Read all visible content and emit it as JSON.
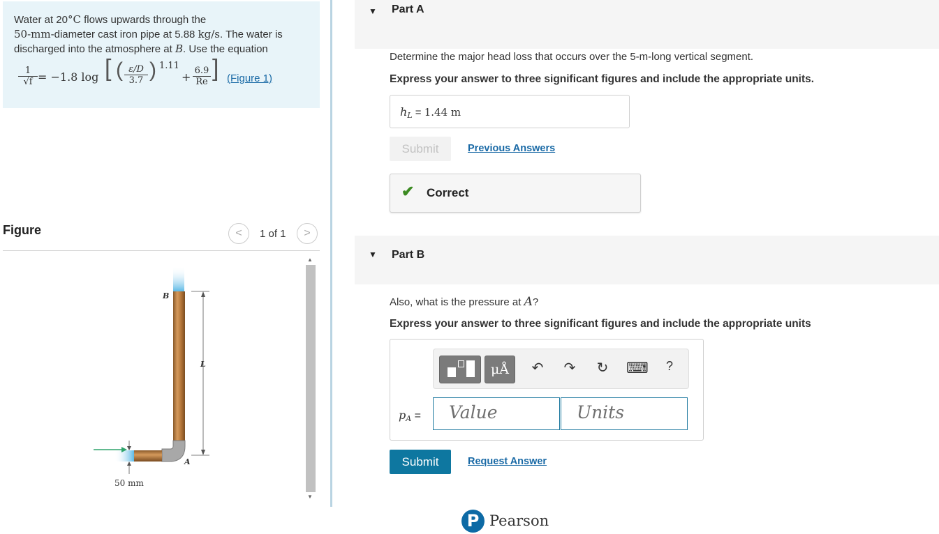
{
  "problem": {
    "line1_pre": "Water at 20",
    "line1_unit": "°C",
    "line1_post": " flows upwards through the",
    "line2_unit": "50-mm",
    "line2_mid": "-diameter cast iron pipe at 5.88 ",
    "line2_rate": "kg/s",
    "line2_post": ". The water is",
    "line3_pre": "discharged into the atmosphere at ",
    "line3_var": "B",
    "line3_post": ". Use the equation",
    "eq_one": "1",
    "eq_sqrtf": "√f",
    "eq_mid": "= −1.8 log",
    "eq_eps": "ε/D",
    "eq_37": "3.7",
    "eq_exp": "1.11",
    "eq_plus": "+",
    "eq_69": "6.9",
    "eq_re": "Re",
    "figure_link": "(Figure 1)"
  },
  "figure": {
    "title": "Figure",
    "counter": "1 of 1",
    "prev": "<",
    "next": ">",
    "label_b": "B",
    "label_l": "L",
    "label_a": "A",
    "label_50mm": "50 mm"
  },
  "partA": {
    "header": "Part A",
    "question": "Determine the major head loss that occurs over the 5-m-long vertical segment.",
    "instruction": "Express your answer to three significant figures and include the appropriate units.",
    "answer_var": "h",
    "answer_sub": "L",
    "answer_eq": " = ",
    "answer_value": "1.44 m",
    "submit": "Submit",
    "previous_answers": "Previous Answers",
    "feedback": "Correct"
  },
  "partB": {
    "header": "Part B",
    "question_pre": "Also, what is the pressure at ",
    "question_var": "A",
    "question_post": "?",
    "instruction": "Express your answer to three significant figures and include the appropriate units",
    "toolbar": {
      "units_btn": "μÅ",
      "undo": "↶",
      "redo": "↷",
      "reset": "↻",
      "keyboard": "⌨",
      "help": "?"
    },
    "label_var": "p",
    "label_sub": "A",
    "label_eq": " =",
    "value_placeholder": "Value",
    "units_placeholder": "Units",
    "submit": "Submit",
    "request_answer": "Request Answer"
  },
  "footer": {
    "logo_letter": "P",
    "brand": "Pearson"
  },
  "colors": {
    "accent": "#0e77a0",
    "correct": "#3b8a21",
    "problem_bg": "#e8f4f9"
  }
}
